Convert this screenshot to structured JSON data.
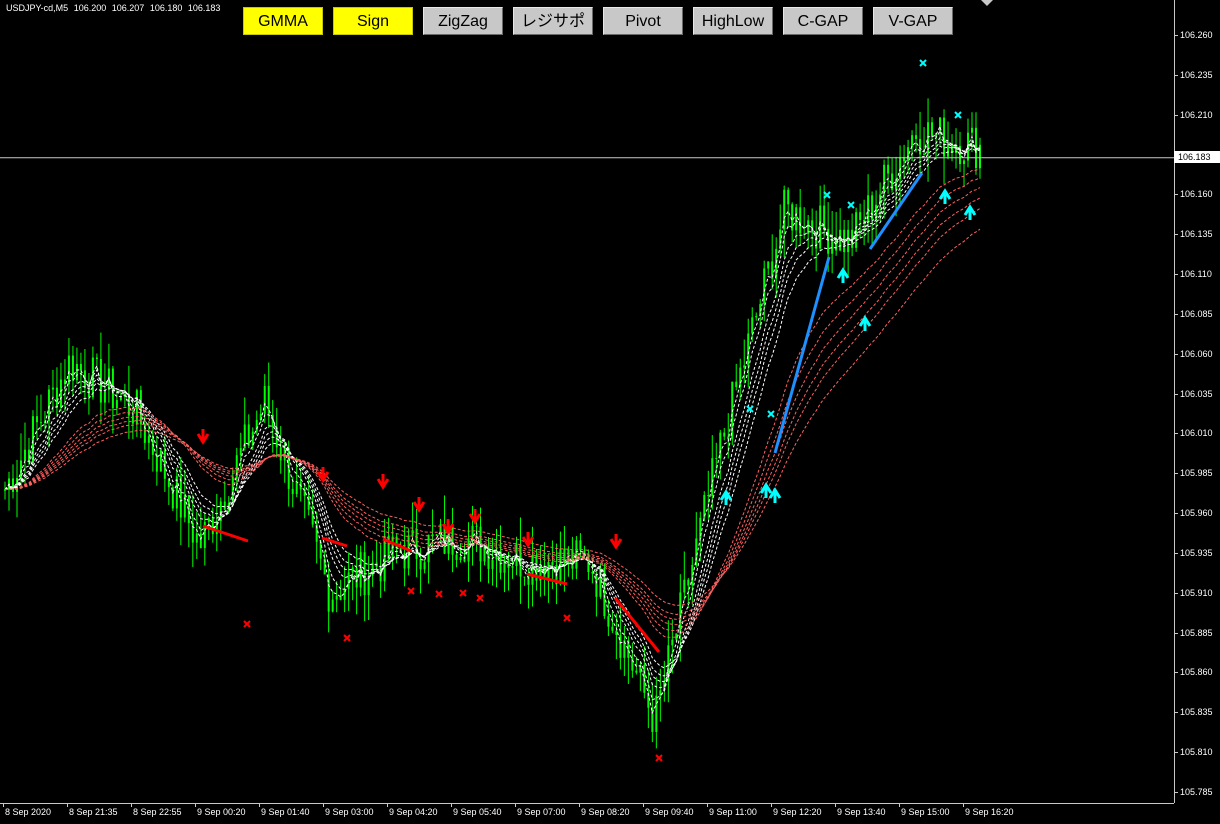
{
  "symbol": {
    "name": "USDJPY-cd,M5",
    "open": "106.200",
    "high": "106.207",
    "low": "106.180",
    "close": "106.183"
  },
  "toolbar": {
    "buttons": [
      {
        "label": "GMMA",
        "active": true
      },
      {
        "label": "Sign",
        "active": true
      },
      {
        "label": "ZigZag",
        "active": false
      },
      {
        "label": "レジサポ",
        "active": false
      },
      {
        "label": "Pivot",
        "active": false
      },
      {
        "label": "HighLow",
        "active": false
      },
      {
        "label": "C-GAP",
        "active": false
      },
      {
        "label": "V-GAP",
        "active": false
      }
    ]
  },
  "price_axis": {
    "current_price": "106.183",
    "ticks": [
      "106.260",
      "106.235",
      "106.210",
      "106.160",
      "106.135",
      "106.110",
      "106.085",
      "106.060",
      "106.035",
      "106.010",
      "105.985",
      "105.960",
      "105.935",
      "105.910",
      "105.885",
      "105.860",
      "105.835",
      "105.810",
      "105.785"
    ]
  },
  "time_axis": {
    "ticks": [
      "8 Sep 2020",
      "8 Sep 21:35",
      "8 Sep 22:55",
      "9 Sep 00:20",
      "9 Sep 01:40",
      "9 Sep 03:00",
      "9 Sep 04:20",
      "9 Sep 05:40",
      "9 Sep 07:00",
      "9 Sep 08:20",
      "9 Sep 09:40",
      "9 Sep 11:00",
      "9 Sep 12:20",
      "9 Sep 13:40",
      "9 Sep 15:00",
      "9 Sep 16:20"
    ]
  },
  "chart_data": {
    "type": "line",
    "title": "USDJPY-cd,M5",
    "xlabel": "",
    "ylabel": "",
    "ylim": [
      105.78,
      106.27
    ],
    "x": [
      "8 Sep 2020",
      "8 Sep 21:35",
      "8 Sep 22:55",
      "9 Sep 00:20",
      "9 Sep 01:40",
      "9 Sep 03:00",
      "9 Sep 04:20",
      "9 Sep 05:40",
      "9 Sep 07:00",
      "9 Sep 08:20",
      "9 Sep 09:40",
      "9 Sep 11:00",
      "9 Sep 12:20",
      "9 Sep 13:40",
      "9 Sep 15:00",
      "9 Sep 16:20"
    ],
    "series": [
      {
        "values": [
          105.975,
          106.055,
          106.025,
          105.94,
          106.03,
          105.91,
          105.935,
          105.945,
          105.93,
          105.93,
          105.83,
          106.0,
          106.15,
          106.13,
          106.2,
          106.19
        ]
      }
    ],
    "colors": {
      "candles": "#00ff00",
      "sell": "#ff0000",
      "buy": "#00ffff",
      "trend_up": "#1e90ff",
      "fast_ema": "#ffffff",
      "slow_ema": "#ff6060"
    },
    "current_price_line": 106.183,
    "grid": false
  }
}
